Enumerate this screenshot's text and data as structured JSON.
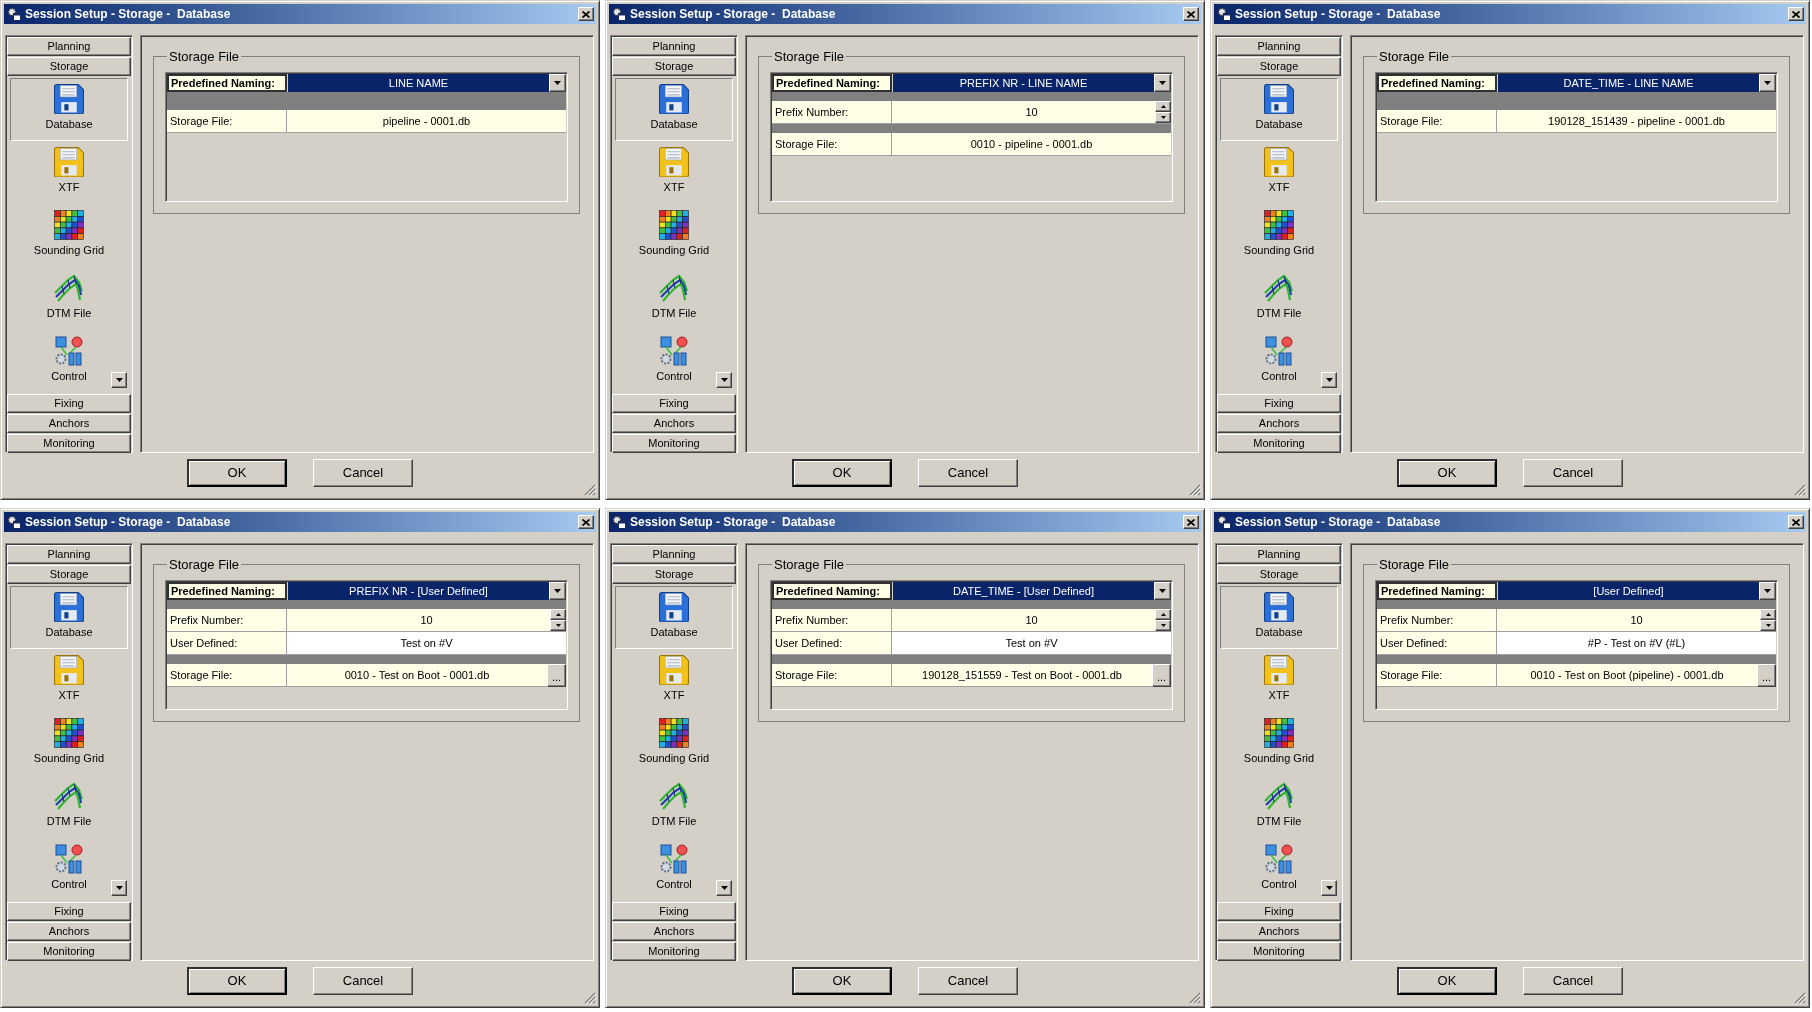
{
  "windows": [
    {
      "title": "Session Setup - Storage -  Database",
      "nav": {
        "sections_above": [
          {
            "label": "Planning"
          },
          {
            "label": "Storage"
          }
        ],
        "items": [
          {
            "kind": "database",
            "label": "Database",
            "selected": true
          },
          {
            "kind": "xtf",
            "label": "XTF",
            "selected": false
          },
          {
            "kind": "grid",
            "label": "Sounding Grid",
            "selected": false
          },
          {
            "kind": "terrain",
            "label": "DTM File",
            "selected": false
          },
          {
            "kind": "control",
            "label": "Control",
            "selected": false
          }
        ],
        "sections_below": [
          {
            "label": "Fixing"
          },
          {
            "label": "Anchors"
          },
          {
            "label": "Monitoring"
          }
        ]
      },
      "group": {
        "title": "Storage File",
        "rows": [
          {
            "kind": "naming",
            "label": "Predefined Naming:",
            "value": "LINE NAME"
          },
          {
            "kind": "file",
            "label": "Storage File:",
            "value": "pipeline - 0001.db"
          }
        ]
      },
      "buttons": [
        {
          "label": "OK",
          "default": true
        },
        {
          "label": "Cancel",
          "default": false
        }
      ]
    },
    {
      "title": "Session Setup - Storage -  Database",
      "nav": {
        "sections_above": [
          {
            "label": "Planning"
          },
          {
            "label": "Storage"
          }
        ],
        "items": [
          {
            "kind": "database",
            "label": "Database",
            "selected": true
          },
          {
            "kind": "xtf",
            "label": "XTF",
            "selected": false
          },
          {
            "kind": "grid",
            "label": "Sounding Grid",
            "selected": false
          },
          {
            "kind": "terrain",
            "label": "DTM File",
            "selected": false
          },
          {
            "kind": "control",
            "label": "Control",
            "selected": false
          }
        ],
        "sections_below": [
          {
            "label": "Fixing"
          },
          {
            "label": "Anchors"
          },
          {
            "label": "Monitoring"
          }
        ]
      },
      "group": {
        "title": "Storage File",
        "rows": [
          {
            "kind": "naming",
            "label": "Predefined Naming:",
            "value": "PREFIX NR - LINE NAME"
          },
          {
            "kind": "spinner",
            "label": "Prefix Number:",
            "value": "10"
          },
          {
            "kind": "file",
            "label": "Storage File:",
            "value": "0010 - pipeline - 0001.db"
          }
        ]
      },
      "buttons": [
        {
          "label": "OK",
          "default": true
        },
        {
          "label": "Cancel",
          "default": false
        }
      ]
    },
    {
      "title": "Session Setup - Storage -  Database",
      "nav": {
        "sections_above": [
          {
            "label": "Planning"
          },
          {
            "label": "Storage"
          }
        ],
        "items": [
          {
            "kind": "database",
            "label": "Database",
            "selected": true
          },
          {
            "kind": "xtf",
            "label": "XTF",
            "selected": false
          },
          {
            "kind": "grid",
            "label": "Sounding Grid",
            "selected": false
          },
          {
            "kind": "terrain",
            "label": "DTM File",
            "selected": false
          },
          {
            "kind": "control",
            "label": "Control",
            "selected": false
          }
        ],
        "sections_below": [
          {
            "label": "Fixing"
          },
          {
            "label": "Anchors"
          },
          {
            "label": "Monitoring"
          }
        ]
      },
      "group": {
        "title": "Storage File",
        "rows": [
          {
            "kind": "naming",
            "label": "Predefined Naming:",
            "value": "DATE_TIME - LINE NAME"
          },
          {
            "kind": "file",
            "label": "Storage File:",
            "value": "190128_151439 - pipeline - 0001.db"
          }
        ]
      },
      "buttons": [
        {
          "label": "OK",
          "default": true
        },
        {
          "label": "Cancel",
          "default": false
        }
      ]
    },
    {
      "title": "Session Setup - Storage -  Database",
      "nav": {
        "sections_above": [
          {
            "label": "Planning"
          },
          {
            "label": "Storage"
          }
        ],
        "items": [
          {
            "kind": "database",
            "label": "Database",
            "selected": true
          },
          {
            "kind": "xtf",
            "label": "XTF",
            "selected": false
          },
          {
            "kind": "grid",
            "label": "Sounding Grid",
            "selected": false
          },
          {
            "kind": "terrain",
            "label": "DTM File",
            "selected": false
          },
          {
            "kind": "control",
            "label": "Control",
            "selected": false
          }
        ],
        "sections_below": [
          {
            "label": "Fixing"
          },
          {
            "label": "Anchors"
          },
          {
            "label": "Monitoring"
          }
        ]
      },
      "group": {
        "title": "Storage File",
        "rows": [
          {
            "kind": "naming",
            "label": "Predefined Naming:",
            "value": "PREFIX NR - [User Defined]"
          },
          {
            "kind": "spinner",
            "label": "Prefix Number:",
            "value": "10"
          },
          {
            "kind": "text",
            "label": "User Defined:",
            "value": "Test on #V"
          },
          {
            "kind": "file",
            "label": "Storage File:",
            "value": "0010 - Test on Boot - 0001.db",
            "browse": "..."
          }
        ]
      },
      "buttons": [
        {
          "label": "OK",
          "default": true
        },
        {
          "label": "Cancel",
          "default": false
        }
      ]
    },
    {
      "title": "Session Setup - Storage -  Database",
      "nav": {
        "sections_above": [
          {
            "label": "Planning"
          },
          {
            "label": "Storage"
          }
        ],
        "items": [
          {
            "kind": "database",
            "label": "Database",
            "selected": true
          },
          {
            "kind": "xtf",
            "label": "XTF",
            "selected": false
          },
          {
            "kind": "grid",
            "label": "Sounding Grid",
            "selected": false
          },
          {
            "kind": "terrain",
            "label": "DTM File",
            "selected": false
          },
          {
            "kind": "control",
            "label": "Control",
            "selected": false
          }
        ],
        "sections_below": [
          {
            "label": "Fixing"
          },
          {
            "label": "Anchors"
          },
          {
            "label": "Monitoring"
          }
        ]
      },
      "group": {
        "title": "Storage File",
        "rows": [
          {
            "kind": "naming",
            "label": "Predefined Naming:",
            "value": "DATE_TIME - [User Defined]"
          },
          {
            "kind": "spinner",
            "label": "Prefix Number:",
            "value": "10"
          },
          {
            "kind": "text",
            "label": "User Defined:",
            "value": "Test on #V"
          },
          {
            "kind": "file",
            "label": "Storage File:",
            "value": "190128_151559 - Test on Boot - 0001.db",
            "browse": "..."
          }
        ]
      },
      "buttons": [
        {
          "label": "OK",
          "default": true
        },
        {
          "label": "Cancel",
          "default": false
        }
      ]
    },
    {
      "title": "Session Setup - Storage -  Database",
      "nav": {
        "sections_above": [
          {
            "label": "Planning"
          },
          {
            "label": "Storage"
          }
        ],
        "items": [
          {
            "kind": "database",
            "label": "Database",
            "selected": true
          },
          {
            "kind": "xtf",
            "label": "XTF",
            "selected": false
          },
          {
            "kind": "grid",
            "label": "Sounding Grid",
            "selected": false
          },
          {
            "kind": "terrain",
            "label": "DTM File",
            "selected": false
          },
          {
            "kind": "control",
            "label": "Control",
            "selected": false
          }
        ],
        "sections_below": [
          {
            "label": "Fixing"
          },
          {
            "label": "Anchors"
          },
          {
            "label": "Monitoring"
          }
        ]
      },
      "group": {
        "title": "Storage File",
        "rows": [
          {
            "kind": "naming",
            "label": "Predefined Naming:",
            "value": "[User Defined]"
          },
          {
            "kind": "spinner",
            "label": "Prefix Number:",
            "value": "10"
          },
          {
            "kind": "text",
            "label": "User Defined:",
            "value": "#P - Test on #V (#L)"
          },
          {
            "kind": "file",
            "label": "Storage File:",
            "value": "0010 - Test on Boot (pipeline) - 0001.db",
            "browse": "..."
          }
        ]
      },
      "buttons": [
        {
          "label": "OK",
          "default": true
        },
        {
          "label": "Cancel",
          "default": false
        }
      ]
    }
  ]
}
